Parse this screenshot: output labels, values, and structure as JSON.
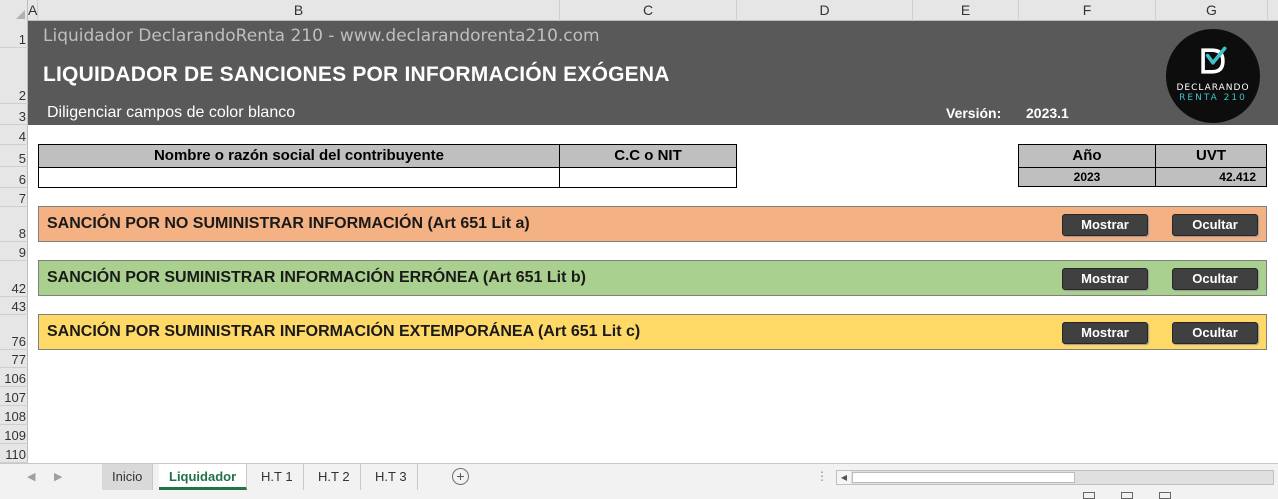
{
  "columns": [
    "A",
    "B",
    "C",
    "D",
    "E",
    "F",
    "G"
  ],
  "rows": [
    "1",
    "2",
    "3",
    "4",
    "5",
    "6",
    "7",
    "8",
    "9",
    "42",
    "43",
    "76",
    "77",
    "106",
    "107",
    "108",
    "109",
    "110"
  ],
  "banner": {
    "site": "Liquidador DeclarandoRenta 210 - www.declarandorenta210.com",
    "title": "LIQUIDADOR DE SANCIONES POR INFORMACIÓN EXÓGENA",
    "subtitle": "Diligenciar campos de color blanco",
    "version_label": "Versión:",
    "version_value": "2023.1",
    "logo_line1": "DECLARANDO",
    "logo_line2": "RENTA 210",
    "colors": {
      "banner_bg": "#595959",
      "logo_bg": "#0d0d0d",
      "logo_accent": "#3fc1c9"
    }
  },
  "taxpayer": {
    "name_header": "Nombre o razón social del contribuyente",
    "id_header": "C.C o NIT",
    "name_value": "",
    "id_value": ""
  },
  "params": {
    "year_header": "Año",
    "uvt_header": "UVT",
    "year_value": "2023",
    "uvt_value": "42.412"
  },
  "sections": [
    {
      "title": "SANCIÓN POR NO SUMINISTRAR INFORMACIÓN (Art 651 Lit a)",
      "show_label": "Mostrar",
      "hide_label": "Ocultar",
      "color": "#f4b183"
    },
    {
      "title": "SANCIÓN POR SUMINISTRAR INFORMACIÓN ERRÓNEA (Art 651 Lit b)",
      "show_label": "Mostrar",
      "hide_label": "Ocultar",
      "color": "#a9d08e"
    },
    {
      "title": "SANCIÓN POR SUMINISTRAR INFORMACIÓN EXTEMPORÁNEA (Art 651 Lit c)",
      "show_label": "Mostrar",
      "hide_label": "Ocultar",
      "color": "#ffd966"
    }
  ],
  "sheet_tabs": [
    {
      "label": "Inicio",
      "state": "inactive"
    },
    {
      "label": "Liquidador",
      "state": "active"
    },
    {
      "label": "H.T 1",
      "state": "inactive"
    },
    {
      "label": "H.T 2",
      "state": "inactive"
    },
    {
      "label": "H.T 3",
      "state": "inactive"
    }
  ],
  "icons": {
    "add_sheet": "plus-circle-icon",
    "nav_prev": "triangle-left-icon",
    "nav_next": "triangle-right-icon",
    "logo_mark": "checkmark-d-logo-icon"
  }
}
